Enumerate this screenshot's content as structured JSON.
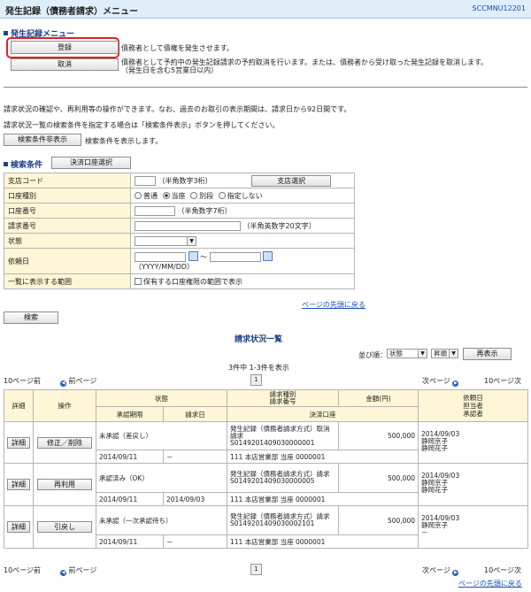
{
  "header": {
    "title": "発生記録（債務者請求）メニュー",
    "code": "SCCMNU12201"
  },
  "menu": {
    "section_title": "発生記録メニュー",
    "register_label": "登録",
    "register_desc": "債務者として債権を発生させます。",
    "cancel_label": "取消",
    "cancel_desc_1": "債務者として予約中の発生記録請求の予約取消を行います。または、債務者から受け取った発生記録を取消します。",
    "cancel_desc_2": "（発生日を含む5営業日以内）"
  },
  "info": {
    "line1": "請求状況の確認や、再利用等の操作ができます。なお、過去のお取引の表示期間は、請求日から92日間です。",
    "line2": "請求状況一覧の検索条件を指定する場合は「検索条件表示」ボタンを押してください。",
    "toggle_btn": "検索条件非表示",
    "toggle_desc": "検索条件を表示します。"
  },
  "search": {
    "section_title": "検索条件",
    "account_btn": "決済口座選択",
    "branch_label": "支店コード",
    "branch_hint": "（半角数字3桁）",
    "branch_btn": "支店選択",
    "acct_type_label": "口座種別",
    "acct_types": [
      "普通",
      "当座",
      "別段",
      "指定しない"
    ],
    "acct_no_label": "口座番号",
    "acct_no_hint": "（半角数字7桁）",
    "req_no_label": "請求番号",
    "req_no_hint": "（半角英数字20文字）",
    "status_label": "状態",
    "date_label": "依頼日",
    "date_tilde": "〜",
    "date_format": "（YYYY/MM/DD）",
    "scope_label": "一覧に表示する範囲",
    "scope_opt": "保有する口座権限の範囲で表示",
    "top_link": "ページの先頭に戻る",
    "search_btn": "検索"
  },
  "list": {
    "title": "請求状況一覧",
    "sort_label": "並び順：",
    "sort_value": "状態",
    "order_value": "昇順",
    "resort_btn": "再表示",
    "count": "3件中 1-3件を表示",
    "prev10": "10ページ前",
    "prev": "前ページ",
    "page": "1",
    "next": "次ページ",
    "next10": "10ページ次",
    "headers": {
      "detail": "詳細",
      "op": "操作",
      "status": "状態",
      "type_no": "請求種別\n請求番号",
      "amount": "金額(円)",
      "req_person": "依頼日\n担当者\n承認者",
      "deadline": "承認期限",
      "req_date": "請求日",
      "settle": "決済口座"
    },
    "rows": [
      {
        "detail": "詳細",
        "op": "修正／削除",
        "status": "未承認（差戻し）",
        "type": "発生記録（債務者請求方式）取消請求",
        "no": "S0149201409030000001",
        "amount": "500,000",
        "date": "2014/09/03",
        "p1": "静岡京子",
        "p2": "静岡花子",
        "deadline": "2014/09/11",
        "req_date": "－",
        "settle": "111 本店営業部 当座 0000001"
      },
      {
        "detail": "詳細",
        "op": "再利用",
        "status": "承認済み（OK）",
        "type": "発生記録（債務者請求方式）請求",
        "no": "S0149201409030000005",
        "amount": "500,000",
        "date": "2014/09/03",
        "p1": "静岡京子",
        "p2": "静岡花子",
        "deadline": "2014/09/11",
        "req_date": "2014/09/03",
        "settle": "111 本店営業部 当座 0000001"
      },
      {
        "detail": "詳細",
        "op": "引戻し",
        "status": "未承認（一次承認待ち）",
        "type": "発生記録（債務者請求方式）請求",
        "no": "S0149201409030002101",
        "amount": "500,000",
        "date": "2014/09/03",
        "p1": "静岡京子",
        "p2": "－",
        "deadline": "2014/09/11",
        "req_date": "－",
        "settle": "111 本店営業部 当座 0000001"
      }
    ],
    "top_link": "ページの先頭に戻る"
  }
}
